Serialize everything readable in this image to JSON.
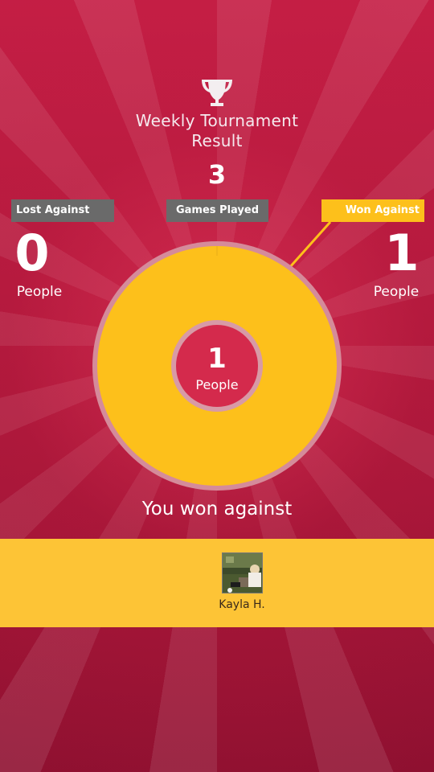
{
  "header": {
    "title_line1": "Weekly Tournament",
    "title_line2": "Result",
    "games_played_count": "3",
    "games_played_label": "Games Played"
  },
  "lost": {
    "label": "Lost Against",
    "count": "0",
    "unit": "People"
  },
  "won": {
    "label": "Won Against",
    "count": "1",
    "unit": "People"
  },
  "center": {
    "count": "1",
    "unit": "People"
  },
  "results_heading": "You won against",
  "opponents": [
    {
      "name": "Kayla H."
    }
  ],
  "colors": {
    "background": "#c41e45",
    "won_accent": "#fdc01b",
    "tag_gray": "#6a6a6a",
    "band": "#fdc436"
  },
  "icons": {
    "trophy": "trophy-icon"
  }
}
